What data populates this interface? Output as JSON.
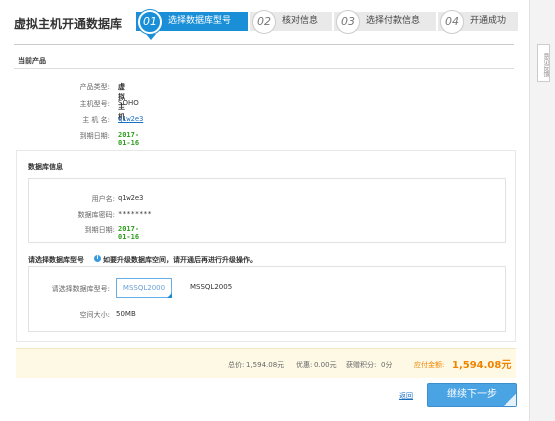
{
  "header": {
    "title": "虚拟主机开通数据库"
  },
  "steps": [
    {
      "num": "01",
      "label": "选择数据库型号",
      "active": true
    },
    {
      "num": "02",
      "label": "核对信息",
      "active": false
    },
    {
      "num": "03",
      "label": "选择付款信息",
      "active": false
    },
    {
      "num": "04",
      "label": "开通成功",
      "active": false
    }
  ],
  "current_product": {
    "title": "当前产品",
    "rows": [
      {
        "label": "产品类型:",
        "value": "虚拟主机"
      },
      {
        "label": "主机型号:",
        "value": "SOHO"
      },
      {
        "label": "主 机 名:",
        "value": "q1w2e3"
      },
      {
        "label": "到期日期:",
        "value": "2017-01-16"
      }
    ]
  },
  "db_info": {
    "title": "数据库信息",
    "rows": [
      {
        "label": "用户名:",
        "value": "q1w2e3"
      },
      {
        "label": "数据库密码:",
        "value": "********"
      },
      {
        "label": "到期日期:",
        "value": "2017-01-16"
      }
    ]
  },
  "db_model": {
    "title": "请选择数据库型号",
    "hint": "如要升级数据库空间，请开通后再进行升级操作。",
    "select_label": "请选择数据库型号:",
    "options": [
      "MSSQL2000",
      "MSSQL2005"
    ],
    "selected": "MSSQL2000",
    "space_label": "空间大小:",
    "space_value": "50MB"
  },
  "summary": {
    "total_label": "总价:",
    "total_value": "1,594.08元",
    "discount_label": "优惠:",
    "discount_value": "0.00元",
    "points_label": "获赠积分:",
    "points_value": "0分",
    "pay_label": "应付金额:",
    "pay_value": "1,594.08元"
  },
  "actions": {
    "back": "返回",
    "continue": "继续下一步"
  },
  "sidebar": {
    "feedback": "意见反馈"
  },
  "colors": {
    "accent": "#1a8fd8",
    "green": "#2b9d1b",
    "orange": "#f08300"
  }
}
